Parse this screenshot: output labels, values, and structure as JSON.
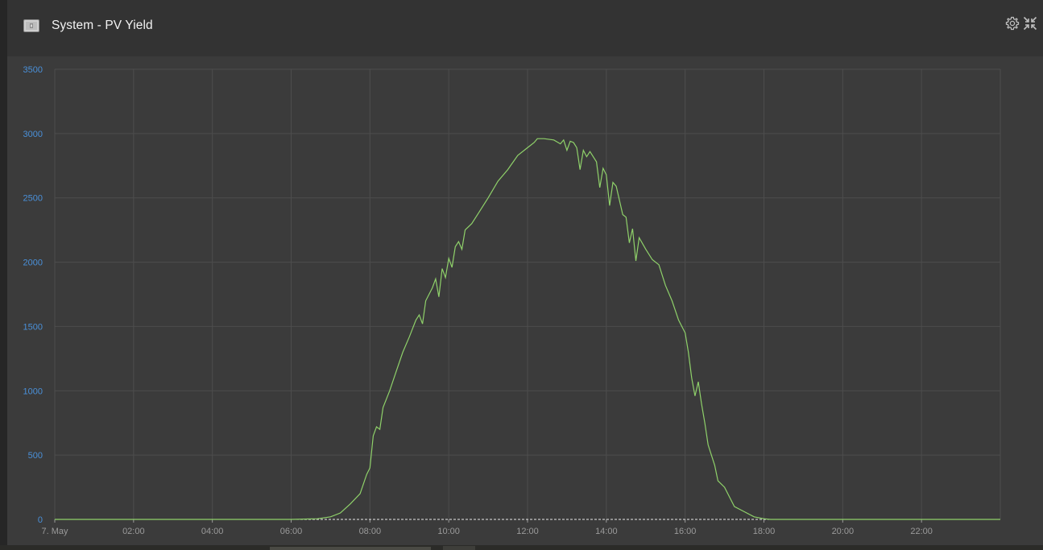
{
  "widget": {
    "title": "System - PV Yield",
    "icons": [
      "solar-panel-icon",
      "gear-icon",
      "collapse-icon"
    ]
  },
  "colors": {
    "series": "#8fd16a",
    "tick_text": "#4a90d9",
    "x_tick_text": "#9a9a9a",
    "grid": "#4d4d4d"
  },
  "chart_data": {
    "type": "line",
    "title": "",
    "xlabel": "",
    "ylabel": "",
    "ylim": [
      0,
      3500
    ],
    "xlim": [
      "00:00",
      "24:00"
    ],
    "y_ticks": [
      "0",
      "500",
      "1000",
      "1500",
      "2000",
      "2500",
      "3000",
      "3500"
    ],
    "x_ticks": [
      {
        "time": "00:00",
        "label": "7. May"
      },
      {
        "time": "02:00",
        "label": "02:00"
      },
      {
        "time": "04:00",
        "label": "04:00"
      },
      {
        "time": "06:00",
        "label": "06:00"
      },
      {
        "time": "08:00",
        "label": "08:00"
      },
      {
        "time": "10:00",
        "label": "10:00"
      },
      {
        "time": "12:00",
        "label": "12:00"
      },
      {
        "time": "14:00",
        "label": "14:00"
      },
      {
        "time": "16:00",
        "label": "16:00"
      },
      {
        "time": "18:00",
        "label": "18:00"
      },
      {
        "time": "20:00",
        "label": "20:00"
      },
      {
        "time": "22:00",
        "label": "22:00"
      }
    ],
    "grid": true,
    "legend": "none",
    "series": [
      {
        "points": [
          [
            "00:00",
            0
          ],
          [
            "06:00",
            0
          ],
          [
            "06:40",
            5
          ],
          [
            "07:00",
            20
          ],
          [
            "07:15",
            50
          ],
          [
            "07:30",
            120
          ],
          [
            "07:45",
            200
          ],
          [
            "07:55",
            350
          ],
          [
            "08:00",
            400
          ],
          [
            "08:05",
            650
          ],
          [
            "08:10",
            720
          ],
          [
            "08:15",
            700
          ],
          [
            "08:20",
            870
          ],
          [
            "08:30",
            1000
          ],
          [
            "08:40",
            1150
          ],
          [
            "08:50",
            1300
          ],
          [
            "09:00",
            1420
          ],
          [
            "09:10",
            1550
          ],
          [
            "09:15",
            1590
          ],
          [
            "09:20",
            1520
          ],
          [
            "09:25",
            1700
          ],
          [
            "09:35",
            1800
          ],
          [
            "09:40",
            1870
          ],
          [
            "09:45",
            1730
          ],
          [
            "09:50",
            1950
          ],
          [
            "09:55",
            1880
          ],
          [
            "10:00",
            2030
          ],
          [
            "10:05",
            1960
          ],
          [
            "10:10",
            2120
          ],
          [
            "10:15",
            2160
          ],
          [
            "10:20",
            2100
          ],
          [
            "10:25",
            2250
          ],
          [
            "10:35",
            2300
          ],
          [
            "10:45",
            2380
          ],
          [
            "11:00",
            2500
          ],
          [
            "11:15",
            2630
          ],
          [
            "11:30",
            2720
          ],
          [
            "11:45",
            2830
          ],
          [
            "12:00",
            2890
          ],
          [
            "12:10",
            2930
          ],
          [
            "12:15",
            2960
          ],
          [
            "12:25",
            2960
          ],
          [
            "12:40",
            2950
          ],
          [
            "12:50",
            2920
          ],
          [
            "12:55",
            2950
          ],
          [
            "13:00",
            2870
          ],
          [
            "13:05",
            2940
          ],
          [
            "13:10",
            2930
          ],
          [
            "13:15",
            2890
          ],
          [
            "13:20",
            2720
          ],
          [
            "13:25",
            2870
          ],
          [
            "13:30",
            2820
          ],
          [
            "13:35",
            2860
          ],
          [
            "13:45",
            2780
          ],
          [
            "13:50",
            2580
          ],
          [
            "13:55",
            2730
          ],
          [
            "14:00",
            2680
          ],
          [
            "14:05",
            2440
          ],
          [
            "14:10",
            2620
          ],
          [
            "14:15",
            2590
          ],
          [
            "14:25",
            2370
          ],
          [
            "14:30",
            2350
          ],
          [
            "14:35",
            2150
          ],
          [
            "14:40",
            2260
          ],
          [
            "14:45",
            2010
          ],
          [
            "14:50",
            2190
          ],
          [
            "15:00",
            2100
          ],
          [
            "15:10",
            2020
          ],
          [
            "15:20",
            1980
          ],
          [
            "15:30",
            1820
          ],
          [
            "15:40",
            1700
          ],
          [
            "15:50",
            1550
          ],
          [
            "16:00",
            1450
          ],
          [
            "16:05",
            1300
          ],
          [
            "16:10",
            1100
          ],
          [
            "16:15",
            960
          ],
          [
            "16:20",
            1070
          ],
          [
            "16:25",
            900
          ],
          [
            "16:30",
            750
          ],
          [
            "16:35",
            580
          ],
          [
            "16:45",
            420
          ],
          [
            "16:50",
            300
          ],
          [
            "17:00",
            250
          ],
          [
            "17:10",
            150
          ],
          [
            "17:15",
            100
          ],
          [
            "17:30",
            60
          ],
          [
            "17:45",
            20
          ],
          [
            "18:00",
            5
          ],
          [
            "18:10",
            0
          ],
          [
            "24:00",
            0
          ]
        ]
      }
    ]
  }
}
